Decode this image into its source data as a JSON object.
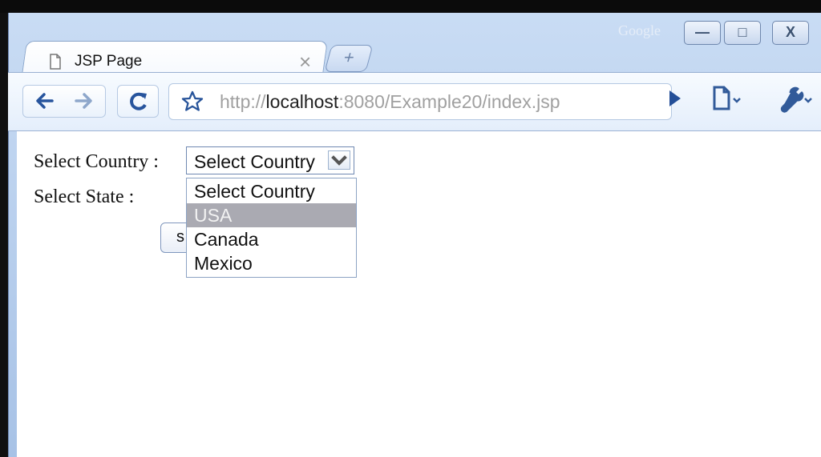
{
  "browser": {
    "brand": "Google",
    "tab": {
      "title": "JSP Page",
      "close": "×"
    },
    "new_tab": "+",
    "url": {
      "scheme": "http://",
      "host": "localhost",
      "rest": ":8080/Example20/index.jsp"
    },
    "controls": {
      "minimize": "—",
      "maximize": "□",
      "close": "X"
    }
  },
  "page": {
    "country_label": "Select Country :",
    "state_label": "Select State :",
    "country_select": {
      "value": "Select Country",
      "options": [
        "Select Country",
        "USA",
        "Canada",
        "Mexico"
      ],
      "highlighted": "USA"
    },
    "submit_button": "s"
  },
  "colors": {
    "window_blue": "#a7c2e6",
    "highlight_gray": "#aaaab2"
  }
}
